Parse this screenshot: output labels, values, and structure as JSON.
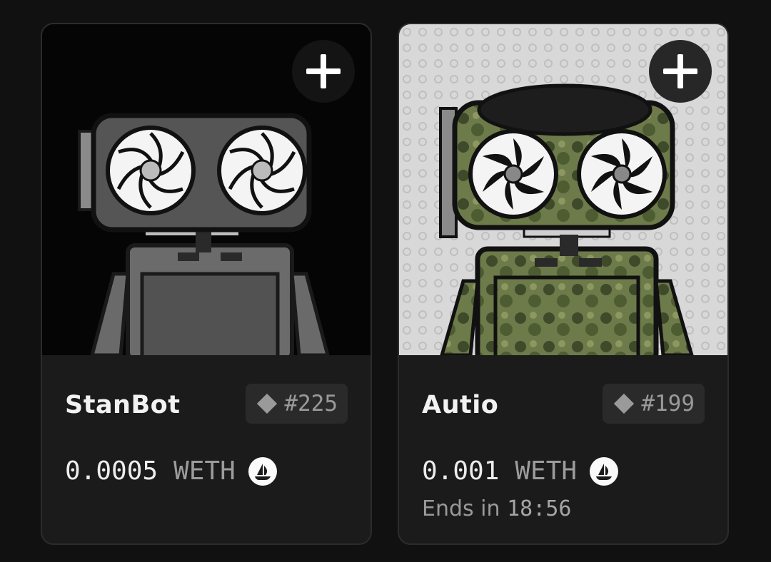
{
  "cards": [
    {
      "name": "StanBot",
      "token": "#225",
      "price": "0.0005",
      "currency": "WETH",
      "art_theme": "grayscale robot with twin fan eyes on black background",
      "add_icon": "plus-icon",
      "marketplace_icon": "opensea-ship-icon"
    },
    {
      "name": "Autio",
      "token": "#199",
      "price": "0.001",
      "currency": "WETH",
      "ends_label": "Ends in",
      "ends_time": "18:56",
      "art_theme": "camo robot with twin fan eyes on light patterned background",
      "add_icon": "plus-icon",
      "marketplace_icon": "opensea-ship-icon"
    }
  ],
  "colors": {
    "page_bg": "#111111",
    "card_bg": "#1b1b1b",
    "card_border": "#2c2c2c",
    "badge_bg": "#2a2a2a",
    "muted_text": "#9a9a9a",
    "title_text": "#f2f2f2"
  }
}
